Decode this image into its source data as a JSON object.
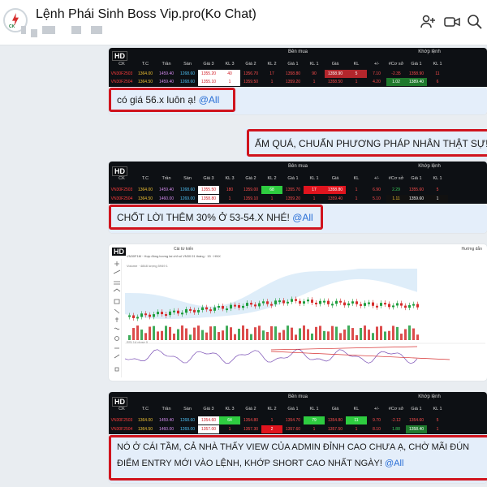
{
  "header": {
    "title": "Lệnh Phái Sinh Boss Vip.pro(Ko Chat)",
    "logo_label": "CK",
    "icons": [
      "add-member-icon",
      "video-call-icon",
      "search-icon",
      "layout-icon"
    ]
  },
  "table_headers": {
    "hd_badge": "HD",
    "ck": "CK",
    "tc": "T.C",
    "tran": "Trần",
    "san": "Sàn",
    "ben_mua": "Bên mua",
    "khop_lenh": "Khớp lệnh",
    "cols": [
      "Giá 3",
      "KL 3",
      "Giá 2",
      "KL 2",
      "Giá 1",
      "KL 1",
      "Giá",
      "KL",
      "+/-",
      "#Cơ sở",
      "Giá 1",
      "KL 1"
    ]
  },
  "messages": [
    {
      "id": "m1",
      "rows": [
        [
          "VN30F2503",
          "1364.00",
          "1459.40",
          "1268.60",
          "1355.20",
          "40",
          "1356.70",
          "17",
          "1358.80",
          "90",
          "1358.90",
          "5",
          "7.10",
          "-2.35",
          "1358.90",
          "11"
        ],
        [
          "VN30F2504",
          "1364.50",
          "1459.40",
          "1268.60",
          "1355.10",
          "1",
          "1359.50",
          "1",
          "1359.20",
          "1",
          "1358.50",
          "1",
          "4.20",
          "1.02",
          "1389.40",
          "6"
        ]
      ],
      "text": "có giá 56.x luôn ạ! ",
      "tag": "@All"
    },
    {
      "id": "m2",
      "text": "ẤM QUÁ, CHUẨN PHƯƠNG PHÁP NHÂN THẬT SỰ! ",
      "tag": "@"
    },
    {
      "id": "m3",
      "rows": [
        [
          "VN30F2503",
          "1364.00",
          "1459.40",
          "1268.60",
          "1355.50",
          "180",
          "1359.00",
          "68",
          "1355.70",
          "17",
          "1358.80",
          "1",
          "6.90",
          "2.29",
          "1355.60",
          "5"
        ],
        [
          "VN30F2504",
          "1364.50",
          "1460.00",
          "1269.00",
          "1358.80",
          "1",
          "1359.10",
          "1",
          "1359.20",
          "1",
          "1359.40",
          "1",
          "5.10",
          "1.11",
          "1359.60",
          "1"
        ]
      ],
      "text": "CHỐT LỜI THÊM 30% Ở 53-54.X NHÉ! ",
      "tag": "@All"
    },
    {
      "id": "m4",
      "chart_title": "VN30F1M · Hợp đồng tương lai chỉ số VN30 01 tháng · 15 · HNX",
      "toolbar": "Cài từ kiến",
      "toolbar_right": "Hướng dẫn",
      "volume_label": "Volume · 4848 lượng 5949 1",
      "rsi_label": "RSI 14 close 0"
    },
    {
      "id": "m5",
      "rows": [
        [
          "VN30F2503",
          "1364.00",
          "1459.40",
          "1268.60",
          "1354.60",
          "64",
          "1354.80",
          "1",
          "1354.70",
          "79",
          "1354.80",
          "11",
          "9.70",
          "-2.12",
          "1354.60",
          "5"
        ],
        [
          "VN30F2504",
          "1364.50",
          "1460.00",
          "1269.00",
          "1357.00",
          "1",
          "1357.30",
          "2",
          "1357.60",
          "1",
          "1357.50",
          "1",
          "8.10",
          "1.88",
          "1358.40",
          "1"
        ]
      ],
      "line1": "NÓ Ở CÁI TẦM, CẢ NHÀ THẤY VIEW CỦA ADMIN ĐỈNH CAO CHƯA Ạ, CHỜ MÃI ĐÚN",
      "line2": "ĐIỂM ENTRY MỚI VÀO LỆNH, KHỚP SHORT CAO NHẤT NGÀY! ",
      "tag": "@All"
    }
  ],
  "colors": {
    "red_box": "#d0141e",
    "tag_blue": "#2a6fd6",
    "bubble": "#e4eefa",
    "table_bg": "#0d1014"
  }
}
